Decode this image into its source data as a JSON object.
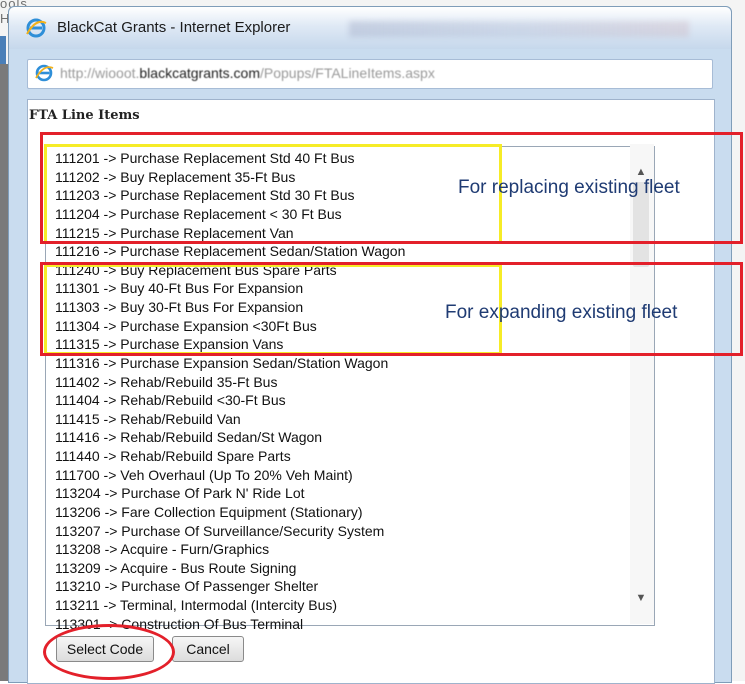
{
  "background": {
    "menu_text": "ools   Help"
  },
  "window": {
    "title": "BlackCat Grants - Internet Explorer",
    "url_prefix": "http://wiooot.",
    "url_domain": "blackcatgrants.com",
    "url_path": "/Popups/FTALineItems.aspx"
  },
  "panel": {
    "title": "FTA Line Items"
  },
  "list": {
    "items": [
      "111201 -> Purchase Replacement Std 40 Ft Bus",
      "111202 -> Buy Replacement 35-Ft Bus",
      "111203 -> Purchase Replacement Std 30 Ft Bus",
      "111204 -> Purchase Replacement < 30 Ft Bus",
      "111215 -> Purchase Replacement Van",
      "111216 -> Purchase Replacement Sedan/Station Wagon",
      "111240 -> Buy Replacement Bus Spare Parts",
      "111301 -> Buy 40-Ft Bus For Expansion",
      "111303 -> Buy 30-Ft Bus For Expansion",
      "111304 -> Purchase Expansion <30Ft Bus",
      "111315 -> Purchase Expansion Vans",
      "111316 -> Purchase Expansion Sedan/Station Wagon",
      "111402 -> Rehab/Rebuild 35-Ft Bus",
      "111404 -> Rehab/Rebuild <30-Ft Bus",
      "111415 -> Rehab/Rebuild Van",
      "111416 -> Rehab/Rebuild Sedan/St Wagon",
      "111440 -> Rehab/Rebuild Spare Parts",
      "111700 -> Veh Overhaul (Up To 20% Veh Maint)",
      "113204 -> Purchase Of Park N' Ride Lot",
      "113206 -> Fare Collection Equipment (Stationary)",
      "113207 -> Purchase Of Surveillance/Security System",
      "113208 -> Acquire - Furn/Graphics",
      "113209 -> Acquire - Bus Route Signing",
      "113210 -> Purchase Of Passenger Shelter",
      "113211 -> Terminal, Intermodal (Intercity Bus)",
      "113301 -> Construction Of Bus Terminal"
    ]
  },
  "buttons": {
    "select_label": "Select Code",
    "cancel_label": "Cancel"
  },
  "annotations": {
    "replacing": "For replacing existing fleet",
    "expanding": "For expanding existing fleet"
  },
  "colors": {
    "annotation_red": "#e3202a",
    "annotation_yellow": "#f6ec27",
    "annotation_text": "#1f3b73"
  },
  "icons": {
    "window": "ie-icon",
    "address": "ie-icon",
    "scroll_up": "chevron-up-icon",
    "scroll_down": "chevron-down-icon"
  }
}
